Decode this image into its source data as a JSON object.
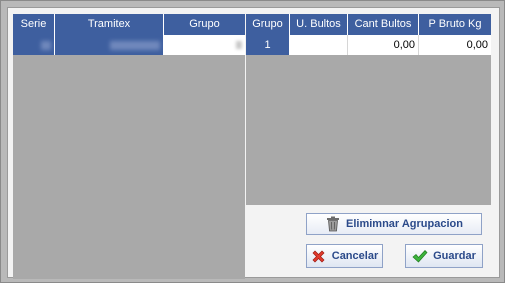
{
  "left_grid": {
    "columns": [
      "Serie",
      "Tramitex",
      "Grupo"
    ],
    "rows": [
      {
        "serie": "",
        "tramitex": "",
        "grupo": ""
      }
    ]
  },
  "right_grid": {
    "columns": [
      "Grupo",
      "U. Bultos",
      "Cant Bultos",
      "P Bruto Kg"
    ],
    "rows": [
      {
        "grupo": "1",
        "u_bultos": "",
        "cant_bultos": "0,00",
        "p_bruto_kg": "0,00"
      }
    ]
  },
  "buttons": {
    "eliminar": "Elimimnar Agrupacion",
    "cancelar": "Cancelar",
    "guardar": "Guardar"
  },
  "icons": {
    "eliminar": "trash-icon",
    "cancelar": "red-x-icon",
    "guardar": "green-check-icon"
  },
  "colors": {
    "header_bg": "#3e5f9f",
    "grid_bg": "#a9a9a9",
    "button_text": "#2b4a8a"
  }
}
